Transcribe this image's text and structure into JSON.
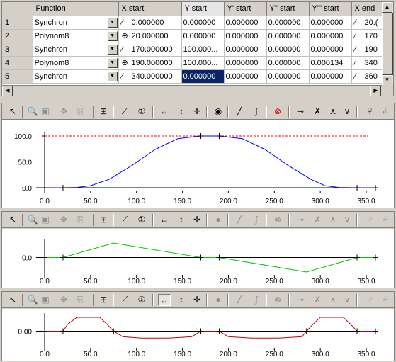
{
  "grid": {
    "columns": [
      "Function",
      "X start",
      "Y start",
      "Y' start",
      "Y'' start",
      "Y''' start",
      "X end"
    ],
    "rows": [
      {
        "num": "1",
        "function": "Synchron",
        "x_icon": "line-segment-icon",
        "x_start": "0.000000",
        "y_start": "0.000000",
        "y1": "0.000000",
        "y2": "0.000000",
        "y3": "0.000000",
        "x_end": "20.(",
        "x_end_icon": "line-segment-icon"
      },
      {
        "num": "2",
        "function": "Polynom8",
        "x_icon": "polynomial-icon",
        "x_start": "20.000000",
        "y_start": "0.000000",
        "y1": "0.000000",
        "y2": "0.000000",
        "y3": "0.000000",
        "x_end": "170",
        "x_end_icon": "line-segment-icon"
      },
      {
        "num": "3",
        "function": "Synchron",
        "x_icon": "line-segment-icon",
        "x_start": "170.000000",
        "y_start": "100.000...",
        "y1": "0.000000",
        "y2": "0.000000",
        "y3": "0.000000",
        "x_end": "190",
        "x_end_icon": "line-segment-icon"
      },
      {
        "num": "4",
        "function": "Polynom8",
        "x_icon": "polynomial-icon",
        "x_start": "190.000000",
        "y_start": "100.000...",
        "y1": "0.000000",
        "y2": "0.000000",
        "y3": "0.000134",
        "x_end": "340",
        "x_end_icon": "line-segment-icon"
      },
      {
        "num": "5",
        "function": "Synchron",
        "x_icon": "line-segment-icon",
        "x_start": "340.000000",
        "y_start": "0.000000",
        "y1": "0.000000",
        "y2": "0.000000",
        "y3": "0.000000",
        "x_end": "360",
        "x_end_icon": "line-segment-icon"
      }
    ],
    "selected_cell": {
      "row": 4,
      "col": "y_start"
    }
  },
  "panels": [
    {
      "name": "position-chart",
      "toggled_tool": null,
      "markers_enabled": true
    },
    {
      "name": "velocity-chart",
      "toggled_tool": null,
      "markers_enabled": false
    },
    {
      "name": "acceleration-chart",
      "toggled_tool": "fit-horizontal",
      "markers_enabled": false
    }
  ],
  "chart_data": [
    {
      "type": "line",
      "series": [
        {
          "color": "#0000ff",
          "x": [
            0,
            20,
            35,
            50,
            70,
            95,
            120,
            145,
            170,
            190,
            215,
            240,
            265,
            290,
            305,
            320,
            340,
            360
          ],
          "y": [
            0,
            0,
            0.5,
            4,
            16,
            43,
            74,
            95,
            100,
            100,
            95,
            74,
            43,
            16,
            4,
            0.5,
            0,
            0
          ]
        }
      ],
      "reference_line": {
        "y": 100,
        "color": "#ff0000",
        "style": "dashed"
      },
      "xticks": [
        "0.0",
        "50.0",
        "100.0",
        "150.0",
        "200.0",
        "250.0",
        "300.0",
        "350.0"
      ],
      "yticks": [
        "0.0",
        "50.0",
        "100.0"
      ],
      "xlim": [
        0,
        360
      ],
      "ylim": [
        0,
        100
      ]
    },
    {
      "type": "line",
      "series": [
        {
          "color": "#00c800",
          "x": [
            0,
            20,
            75,
            170,
            190,
            285,
            340,
            360
          ],
          "y": [
            0,
            0,
            1,
            0,
            0,
            -1,
            0,
            0
          ]
        }
      ],
      "xticks": [
        "0.0",
        "50.0",
        "100.0",
        "150.0",
        "200.0",
        "250.0",
        "300.0",
        "350.0"
      ],
      "yticks": [
        "0.0"
      ],
      "xlim": [
        0,
        360
      ],
      "ylim": [
        -1,
        1
      ]
    },
    {
      "type": "line",
      "series": [
        {
          "color": "#c00000",
          "x": [
            0,
            20,
            25,
            35,
            60,
            68,
            75,
            85,
            105,
            135,
            160,
            165,
            170,
            190,
            195,
            200,
            225,
            255,
            280,
            285,
            292,
            300,
            325,
            333,
            340,
            360
          ],
          "y": [
            0,
            0,
            0.5,
            1,
            1,
            0.5,
            0,
            -0.4,
            -0.5,
            -0.5,
            -0.4,
            -0.2,
            0,
            0,
            -0.2,
            -0.4,
            -0.5,
            -0.5,
            -0.4,
            0,
            0.5,
            1,
            1,
            0.5,
            0,
            0
          ]
        }
      ],
      "xticks": [
        "0.0",
        "50.0",
        "100.0",
        "150.0",
        "200.0",
        "250.0",
        "300.0",
        "350.0"
      ],
      "yticks": [
        "0.00"
      ],
      "xlim": [
        0,
        360
      ],
      "ylim": [
        -1,
        1
      ]
    }
  ]
}
